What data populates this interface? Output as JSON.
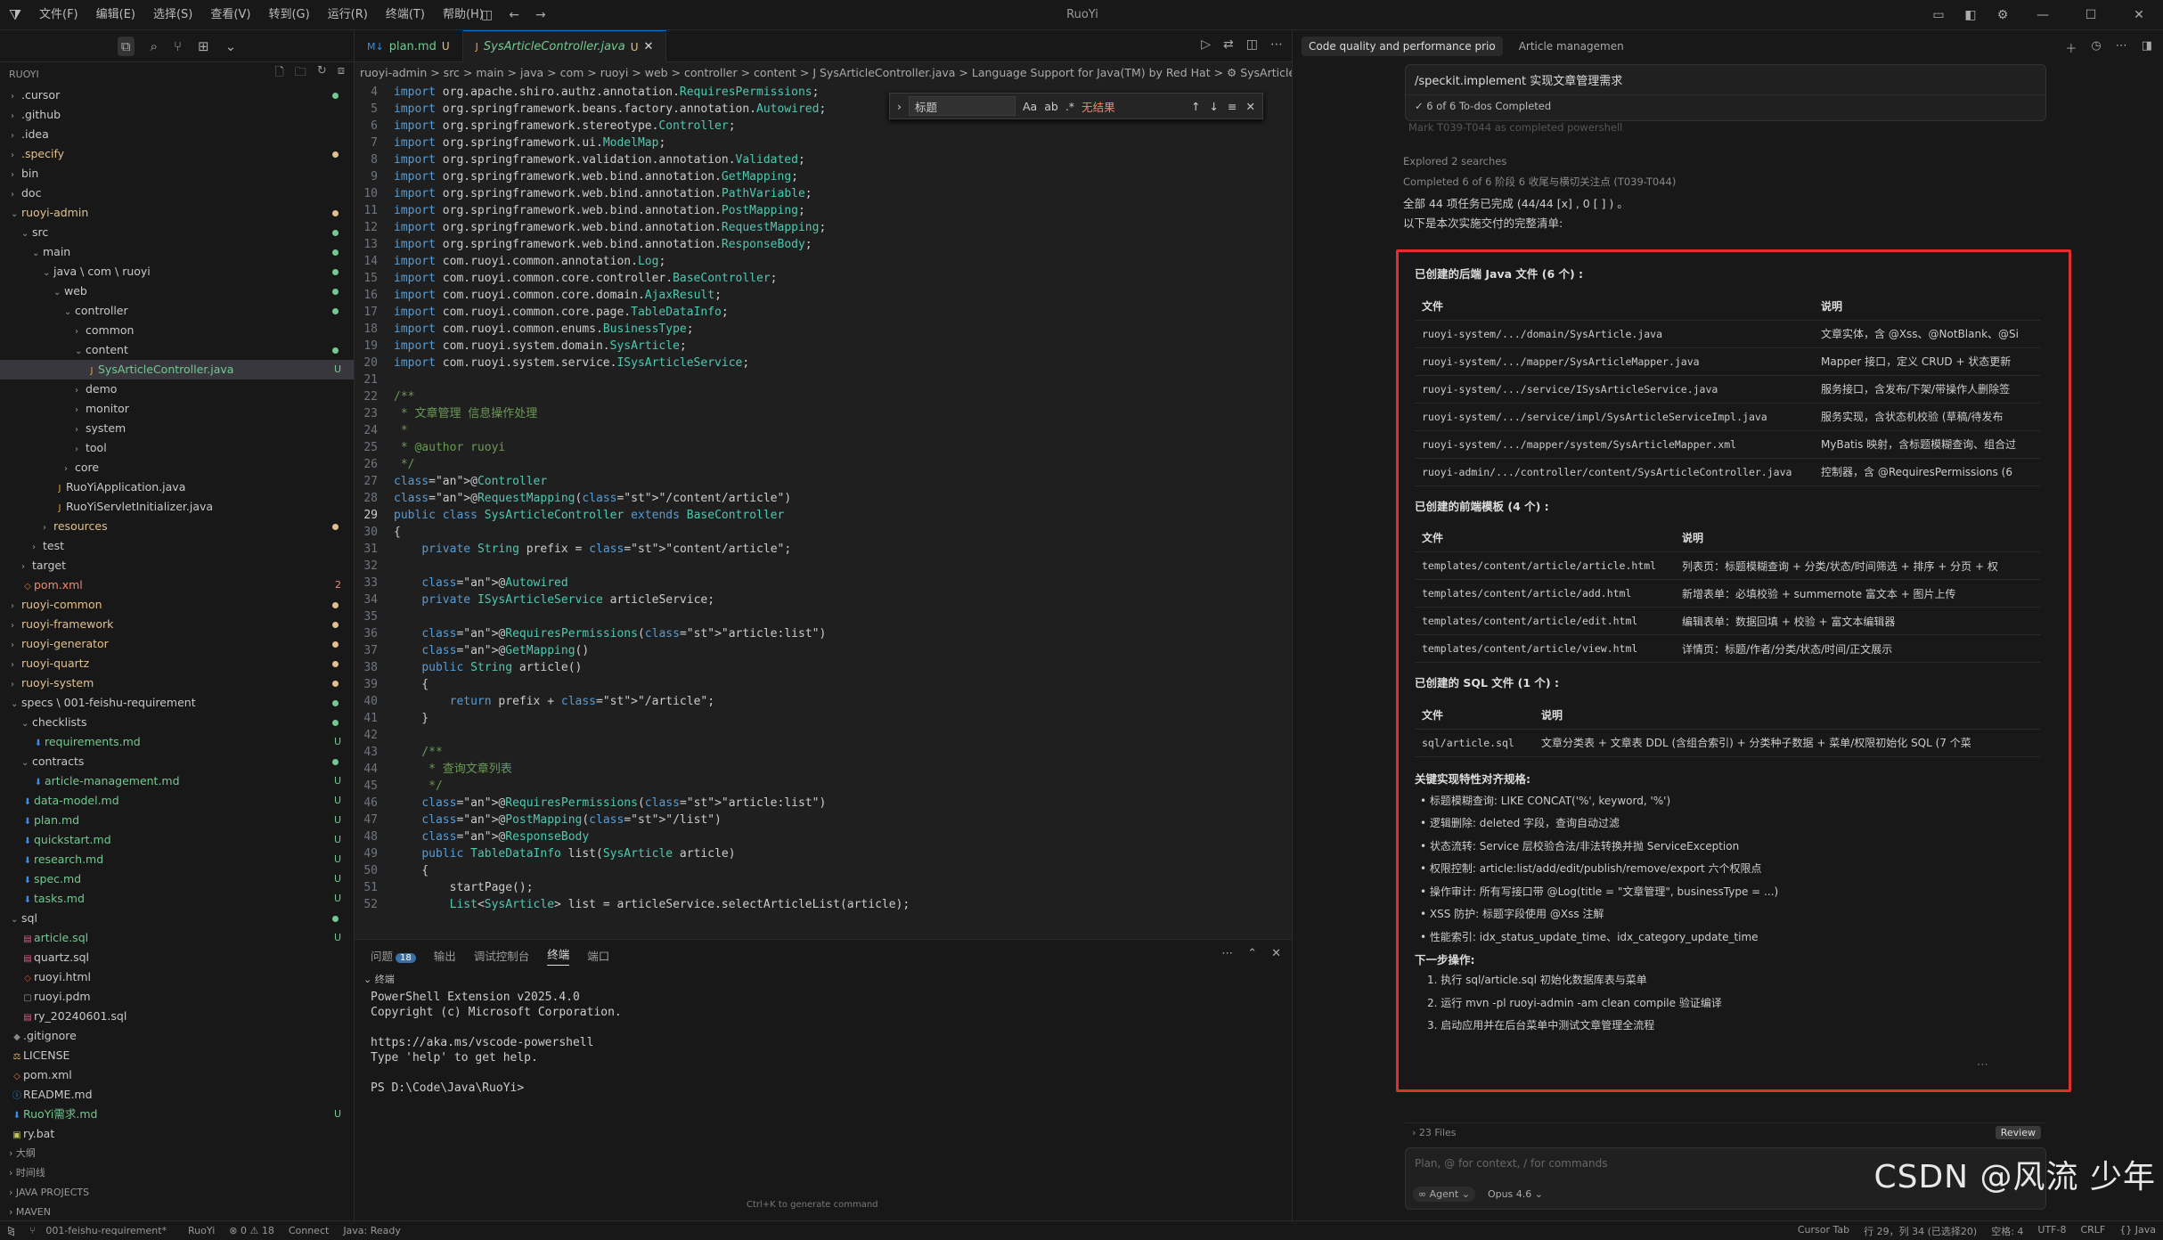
{
  "window": {
    "title": "RuoYi"
  },
  "menu": [
    "文件(F)",
    "编辑(E)",
    "选择(S)",
    "查看(V)",
    "转到(G)",
    "运行(R)",
    "终端(T)",
    "帮助(H)"
  ],
  "explorer": {
    "root": "RUOYI",
    "items": [
      {
        "label": ".cursor",
        "depth": 0,
        "kind": "folder",
        "open": false,
        "status": "green"
      },
      {
        "label": ".github",
        "depth": 0,
        "kind": "folder",
        "open": false,
        "status": ""
      },
      {
        "label": ".idea",
        "depth": 0,
        "kind": "folder",
        "open": false,
        "status": ""
      },
      {
        "label": ".specify",
        "depth": 0,
        "kind": "folder",
        "open": false,
        "status": "orange"
      },
      {
        "label": "bin",
        "depth": 0,
        "kind": "folder",
        "open": false,
        "status": ""
      },
      {
        "label": "doc",
        "depth": 0,
        "kind": "folder",
        "open": false,
        "status": ""
      },
      {
        "label": "ruoyi-admin",
        "depth": 0,
        "kind": "folder",
        "open": true,
        "status": "orange"
      },
      {
        "label": "src",
        "depth": 1,
        "kind": "folder",
        "open": true,
        "status": "green"
      },
      {
        "label": "main",
        "depth": 2,
        "kind": "folder",
        "open": true,
        "status": "green"
      },
      {
        "label": "java \\ com \\ ruoyi",
        "depth": 3,
        "kind": "folder",
        "open": true,
        "status": "green"
      },
      {
        "label": "web",
        "depth": 4,
        "kind": "folder",
        "open": true,
        "status": "green"
      },
      {
        "label": "controller",
        "depth": 5,
        "kind": "folder",
        "open": true,
        "status": "green"
      },
      {
        "label": "common",
        "depth": 6,
        "kind": "folder",
        "open": false,
        "status": ""
      },
      {
        "label": "content",
        "depth": 6,
        "kind": "folder",
        "open": true,
        "status": "green"
      },
      {
        "label": "SysArticleController.java",
        "depth": 7,
        "kind": "java",
        "open": false,
        "status": "U",
        "selected": true
      },
      {
        "label": "demo",
        "depth": 6,
        "kind": "folder",
        "open": false,
        "status": ""
      },
      {
        "label": "monitor",
        "depth": 6,
        "kind": "folder",
        "open": false,
        "status": ""
      },
      {
        "label": "system",
        "depth": 6,
        "kind": "folder",
        "open": false,
        "status": ""
      },
      {
        "label": "tool",
        "depth": 6,
        "kind": "folder",
        "open": false,
        "status": ""
      },
      {
        "label": "core",
        "depth": 5,
        "kind": "folder",
        "open": false,
        "status": ""
      },
      {
        "label": "RuoYiApplication.java",
        "depth": 4,
        "kind": "java",
        "open": false,
        "status": ""
      },
      {
        "label": "RuoYiServletInitializer.java",
        "depth": 4,
        "kind": "java",
        "open": false,
        "status": ""
      },
      {
        "label": "resources",
        "depth": 3,
        "kind": "folder",
        "open": false,
        "status": "orange"
      },
      {
        "label": "test",
        "depth": 2,
        "kind": "folder",
        "open": false,
        "status": ""
      },
      {
        "label": "target",
        "depth": 1,
        "kind": "folder",
        "open": false,
        "status": ""
      },
      {
        "label": "pom.xml",
        "depth": 1,
        "kind": "xml",
        "open": false,
        "status": "2"
      },
      {
        "label": "ruoyi-common",
        "depth": 0,
        "kind": "folder",
        "open": false,
        "status": "orange"
      },
      {
        "label": "ruoyi-framework",
        "depth": 0,
        "kind": "folder",
        "open": false,
        "status": "orange"
      },
      {
        "label": "ruoyi-generator",
        "depth": 0,
        "kind": "folder",
        "open": false,
        "status": "orange"
      },
      {
        "label": "ruoyi-quartz",
        "depth": 0,
        "kind": "folder",
        "open": false,
        "status": "orange"
      },
      {
        "label": "ruoyi-system",
        "depth": 0,
        "kind": "folder",
        "open": false,
        "status": "orange"
      },
      {
        "label": "specs \\ 001-feishu-requirement",
        "depth": 0,
        "kind": "folder",
        "open": true,
        "status": "green"
      },
      {
        "label": "checklists",
        "depth": 1,
        "kind": "folder",
        "open": true,
        "status": "green"
      },
      {
        "label": "requirements.md",
        "depth": 2,
        "kind": "md",
        "open": false,
        "status": "U"
      },
      {
        "label": "contracts",
        "depth": 1,
        "kind": "folder",
        "open": true,
        "status": "green"
      },
      {
        "label": "article-management.md",
        "depth": 2,
        "kind": "md",
        "open": false,
        "status": "U"
      },
      {
        "label": "data-model.md",
        "depth": 1,
        "kind": "md",
        "open": false,
        "status": "U"
      },
      {
        "label": "plan.md",
        "depth": 1,
        "kind": "md",
        "open": false,
        "status": "U"
      },
      {
        "label": "quickstart.md",
        "depth": 1,
        "kind": "md",
        "open": false,
        "status": "U"
      },
      {
        "label": "research.md",
        "depth": 1,
        "kind": "md",
        "open": false,
        "status": "U"
      },
      {
        "label": "spec.md",
        "depth": 1,
        "kind": "md",
        "open": false,
        "status": "U"
      },
      {
        "label": "tasks.md",
        "depth": 1,
        "kind": "md",
        "open": false,
        "status": "U"
      },
      {
        "label": "sql",
        "depth": 0,
        "kind": "folder",
        "open": true,
        "status": "green"
      },
      {
        "label": "article.sql",
        "depth": 1,
        "kind": "sql",
        "open": false,
        "status": "U"
      },
      {
        "label": "quartz.sql",
        "depth": 1,
        "kind": "sql",
        "open": false,
        "status": ""
      },
      {
        "label": "ruoyi.html",
        "depth": 1,
        "kind": "html",
        "open": false,
        "status": ""
      },
      {
        "label": "ruoyi.pdm",
        "depth": 1,
        "kind": "file",
        "open": false,
        "status": ""
      },
      {
        "label": "ry_20240601.sql",
        "depth": 1,
        "kind": "sql",
        "open": false,
        "status": ""
      },
      {
        "label": ".gitignore",
        "depth": 0,
        "kind": "git",
        "open": false,
        "status": ""
      },
      {
        "label": "LICENSE",
        "depth": 0,
        "kind": "lic",
        "open": false,
        "status": ""
      },
      {
        "label": "pom.xml",
        "depth": 0,
        "kind": "xml",
        "open": false,
        "status": ""
      },
      {
        "label": "README.md",
        "depth": 0,
        "kind": "info",
        "open": false,
        "status": ""
      },
      {
        "label": "RuoYi需求.md",
        "depth": 0,
        "kind": "md",
        "open": false,
        "status": "U"
      },
      {
        "label": "ry.bat",
        "depth": 0,
        "kind": "bat",
        "open": false,
        "status": ""
      }
    ],
    "sections": [
      "大纲",
      "时间线",
      "JAVA PROJECTS",
      "MAVEN"
    ]
  },
  "tabs": [
    {
      "label": "plan.md",
      "status": "U",
      "active": false
    },
    {
      "label": "SysArticleController.java",
      "status": "U",
      "active": true
    }
  ],
  "breadcrumb": "ruoyi-admin > src > main > java > com > ruoyi > web > controller > content > J SysArticleController.java > Language Support for Java(TM) by Red Hat > ⚙ SysArticleController",
  "find": {
    "value": "标题",
    "result": "无结果"
  },
  "code": [
    {
      "n": 4,
      "t": "import org.apache.shiro.authz.annotation.RequiresPermissions;"
    },
    {
      "n": 5,
      "t": "import org.springframework.beans.factory.annotation.Autowired;"
    },
    {
      "n": 6,
      "t": "import org.springframework.stereotype.Controller;"
    },
    {
      "n": 7,
      "t": "import org.springframework.ui.ModelMap;"
    },
    {
      "n": 8,
      "t": "import org.springframework.validation.annotation.Validated;"
    },
    {
      "n": 9,
      "t": "import org.springframework.web.bind.annotation.GetMapping;"
    },
    {
      "n": 10,
      "t": "import org.springframework.web.bind.annotation.PathVariable;"
    },
    {
      "n": 11,
      "t": "import org.springframework.web.bind.annotation.PostMapping;"
    },
    {
      "n": 12,
      "t": "import org.springframework.web.bind.annotation.RequestMapping;"
    },
    {
      "n": 13,
      "t": "import org.springframework.web.bind.annotation.ResponseBody;"
    },
    {
      "n": 14,
      "t": "import com.ruoyi.common.annotation.Log;"
    },
    {
      "n": 15,
      "t": "import com.ruoyi.common.core.controller.BaseController;"
    },
    {
      "n": 16,
      "t": "import com.ruoyi.common.core.domain.AjaxResult;"
    },
    {
      "n": 17,
      "t": "import com.ruoyi.common.core.page.TableDataInfo;"
    },
    {
      "n": 18,
      "t": "import com.ruoyi.common.enums.BusinessType;"
    },
    {
      "n": 19,
      "t": "import com.ruoyi.system.domain.SysArticle;"
    },
    {
      "n": 20,
      "t": "import com.ruoyi.system.service.ISysArticleService;"
    },
    {
      "n": 21,
      "t": ""
    },
    {
      "n": 22,
      "t": "/**"
    },
    {
      "n": 23,
      "t": " * 文章管理 信息操作处理"
    },
    {
      "n": 24,
      "t": " *"
    },
    {
      "n": 25,
      "t": " * @author ruoyi"
    },
    {
      "n": 26,
      "t": " */"
    },
    {
      "n": 27,
      "t": "@Controller"
    },
    {
      "n": 28,
      "t": "@RequestMapping(\"/content/article\")"
    },
    {
      "n": 29,
      "t": "public class SysArticleController extends BaseController"
    },
    {
      "n": 30,
      "t": "{"
    },
    {
      "n": 31,
      "t": "    private String prefix = \"content/article\";"
    },
    {
      "n": 32,
      "t": ""
    },
    {
      "n": 33,
      "t": "    @Autowired"
    },
    {
      "n": 34,
      "t": "    private ISysArticleService articleService;"
    },
    {
      "n": 35,
      "t": ""
    },
    {
      "n": 36,
      "t": "    @RequiresPermissions(\"article:list\")"
    },
    {
      "n": 37,
      "t": "    @GetMapping()"
    },
    {
      "n": 38,
      "t": "    public String article()"
    },
    {
      "n": 39,
      "t": "    {"
    },
    {
      "n": 40,
      "t": "        return prefix + \"/article\";"
    },
    {
      "n": 41,
      "t": "    }"
    },
    {
      "n": 42,
      "t": ""
    },
    {
      "n": 43,
      "t": "    /**"
    },
    {
      "n": 44,
      "t": "     * 查询文章列表"
    },
    {
      "n": 45,
      "t": "     */"
    },
    {
      "n": 46,
      "t": "    @RequiresPermissions(\"article:list\")"
    },
    {
      "n": 47,
      "t": "    @PostMapping(\"/list\")"
    },
    {
      "n": 48,
      "t": "    @ResponseBody"
    },
    {
      "n": 49,
      "t": "    public TableDataInfo list(SysArticle article)"
    },
    {
      "n": 50,
      "t": "    {"
    },
    {
      "n": 51,
      "t": "        startPage();"
    },
    {
      "n": 52,
      "t": "        List<SysArticle> list = articleService.selectArticleList(article);"
    }
  ],
  "panel": {
    "tabs": [
      "问题",
      "输出",
      "调试控制台",
      "终端",
      "端口"
    ],
    "problems_count": "18",
    "active": "终端",
    "terminal_header": "终端",
    "terminal_lines": [
      "PowerShell Extension v2025.4.0",
      "Copyright (c) Microsoft Corporation.",
      "",
      "https://aka.ms/vscode-powershell",
      "Type 'help' to get help.",
      "",
      "PS D:\\Code\\Java\\RuoYi> "
    ],
    "hint": "Ctrl+K to generate command"
  },
  "chat": {
    "tabs": [
      "Code quality and performance prio",
      "Article managemen"
    ],
    "prompt": "/speckit.implement 实现文章管理需求",
    "todos": "6 of 6 To-dos Completed",
    "faded": "Mark T039-T044 as completed powershell",
    "explored": "Explored 2 searches",
    "completed": "Completed 6 of 6  阶段 6 收尾与横切关注点 (T039-T044)",
    "summary": "全部 44 项任务已完成 (44/44 [x] , 0 [ ] ) 。",
    "intro": "以下是本次实施交付的完整清单:",
    "sec_backend": "已创建的后端 Java 文件 (6 个) :",
    "sec_frontend": "已创建的前端模板 (4 个) :",
    "sec_sql": "已创建的 SQL 文件 (1 个) :",
    "col_file": "文件",
    "col_desc": "说明",
    "backend": [
      {
        "f": "ruoyi-system/.../domain/SysArticle.java",
        "d": "文章实体，含 @Xss、@NotBlank、@Si"
      },
      {
        "f": "ruoyi-system/.../mapper/SysArticleMapper.java",
        "d": "Mapper 接口，定义 CRUD + 状态更新"
      },
      {
        "f": "ruoyi-system/.../service/ISysArticleService.java",
        "d": "服务接口，含发布/下架/带操作人删除签"
      },
      {
        "f": "ruoyi-system/.../service/impl/SysArticleServiceImpl.java",
        "d": "服务实现，含状态机校验 (草稿/待发布"
      },
      {
        "f": "ruoyi-system/.../mapper/system/SysArticleMapper.xml",
        "d": "MyBatis 映射，含标题模糊查询、组合过"
      },
      {
        "f": "ruoyi-admin/.../controller/content/SysArticleController.java",
        "d": "控制器，含 @RequiresPermissions (6"
      }
    ],
    "frontend": [
      {
        "f": "templates/content/article/article.html",
        "d": "列表页：标题模糊查询 + 分类/状态/时间筛选 + 排序 + 分页 + 权"
      },
      {
        "f": "templates/content/article/add.html",
        "d": "新增表单：必填校验 + summernote 富文本 + 图片上传"
      },
      {
        "f": "templates/content/article/edit.html",
        "d": "编辑表单：数据回填 + 校验 + 富文本编辑器"
      },
      {
        "f": "templates/content/article/view.html",
        "d": "详情页：标题/作者/分类/状态/时间/正文展示"
      }
    ],
    "sql": [
      {
        "f": "sql/article.sql",
        "d": "文章分类表 + 文章表 DDL (含组合索引) + 分类种子数据 + 菜单/权限初始化 SQL (7 个菜"
      }
    ],
    "sec_key": "关键实现特性对齐规格:",
    "features": [
      "标题模糊查询: LIKE CONCAT('%', keyword, '%')",
      "逻辑删除: deleted 字段，查询自动过滤",
      "状态流转: Service 层校验合法/非法转换并抛 ServiceException",
      "权限控制: article:list/add/edit/publish/remove/export 六个权限点",
      "操作审计: 所有写接口带 @Log(title = \"文章管理\", businessType = ...)",
      "XSS 防护: 标题字段使用 @Xss 注解",
      "性能索引: idx_status_update_time、idx_category_update_time"
    ],
    "sec_next": "下一步操作:",
    "next": [
      "1. 执行 sql/article.sql 初始化数据库表与菜单",
      "2. 运行 mvn -pl ruoyi-admin -am clean compile 验证编译",
      "3. 启动应用并在后台菜单中测试文章管理全流程"
    ],
    "files_count": "23 Files",
    "review": "Review",
    "input_placeholder": "Plan, @ for context, / for commands",
    "agent": "∞ Agent ⌄",
    "model": "Opus 4.6 ⌄",
    "watermark": "CSDN @风流 少年"
  },
  "statusbar": {
    "branch": "001-feishu-requirement*",
    "project": "RuoYi",
    "problems": "⊗ 0 ⚠ 18",
    "connect": "Connect",
    "java": "Java: Ready",
    "right": [
      "Cursor Tab",
      "行 29，列 34 (已选择20)",
      "空格: 4",
      "UTF-8",
      "CRLF",
      "{} Java"
    ]
  }
}
